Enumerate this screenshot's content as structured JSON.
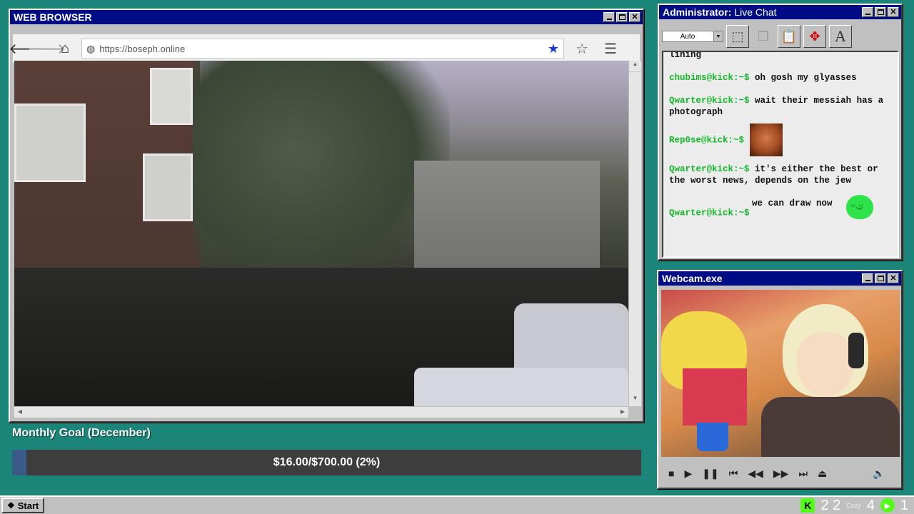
{
  "browser": {
    "title": "WEB BROWSER",
    "url": "https://boseph.online",
    "back_icon": "left-arrow-icon",
    "forward_icon": "right-arrow-icon",
    "home_icon": "home-icon",
    "bookmark_icon": "star-icon",
    "menu_icon": "hamburger-icon"
  },
  "goal": {
    "title": "Monthly Goal (December)",
    "text": "$16.00/$700.00 (2%)",
    "progress": 0.023,
    "bar_color": "#3a5a8a"
  },
  "chat": {
    "title_prefix": "Administrator:",
    "title": "Live Chat",
    "font_size_select": "Auto",
    "messages": [
      {
        "user": "",
        "text": "lining"
      },
      {
        "user": "chubims@kick:~$",
        "text": "oh gosh my glyasses"
      },
      {
        "user": "Qwarter@kick:~$",
        "text": "wait their messiah has a photograph"
      },
      {
        "user": "Rep0se@kick:~$",
        "text": "",
        "emote": "laughing-man-emote"
      },
      {
        "user": "Qwarter@kick:~$",
        "text": "it's either the best or the worst news, depends on the jew"
      },
      {
        "user": "",
        "text": "we can draw now"
      },
      {
        "user": "Qwarter@kick:~$",
        "text": "",
        "emote": "green-blob-emote"
      }
    ]
  },
  "webcam": {
    "title": "Webcam.exe"
  },
  "taskbar": {
    "start": "Start",
    "tray_count_1": "2 2",
    "tray_small": "Cozy",
    "tray_count_2": "4",
    "tray_count_3": "1"
  },
  "colors": {
    "desktop": "#1a8578",
    "titlebar": "#000c86",
    "chat_user": "#13b829",
    "kick_green": "#53fc18"
  }
}
